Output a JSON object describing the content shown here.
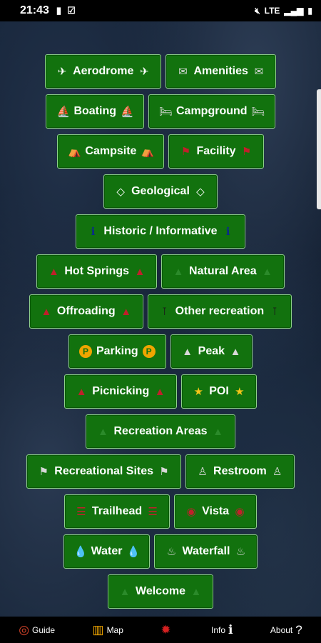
{
  "status": {
    "time": "21:43",
    "left_icons": [
      "bag-icon",
      "check-box-icon"
    ],
    "right_icons": [
      "mute-icon",
      "LTE",
      "signal-icon",
      "battery-icon"
    ],
    "lte": "LTE"
  },
  "buttons": [
    {
      "label": "Aerodrome",
      "icon": "✈",
      "color": "white",
      "name": "aerodrome"
    },
    {
      "label": "Amenities",
      "icon": "✉",
      "color": "grey",
      "name": "amenities"
    },
    {
      "label": "Boating",
      "icon": "⛵",
      "color": "navy",
      "name": "boating"
    },
    {
      "label": "Campground",
      "icon": "🛏",
      "color": "grey",
      "name": "campground"
    },
    {
      "label": "Campsite",
      "icon": "⛺",
      "color": "olive",
      "name": "campsite"
    },
    {
      "label": "Facility",
      "icon": "⚑",
      "color": "red",
      "name": "facility"
    },
    {
      "label": "Geological",
      "icon": "◇",
      "color": "white",
      "name": "geological"
    },
    {
      "label": "Historic / Informative",
      "icon": "ℹ",
      "color": "navy",
      "name": "historic-informative"
    },
    {
      "label": "Hot Springs",
      "icon": "▲",
      "color": "red",
      "name": "hot-springs"
    },
    {
      "label": "Natural Area",
      "icon": "▲",
      "color": "green",
      "name": "natural-area"
    },
    {
      "label": "Offroading",
      "icon": "▲",
      "color": "red",
      "name": "offroading"
    },
    {
      "label": "Other recreation",
      "icon": "⊺",
      "color": "dark",
      "name": "other-recreation"
    },
    {
      "label": "Parking",
      "icon": "P",
      "color": "gold",
      "name": "parking"
    },
    {
      "label": "Peak",
      "icon": "▲",
      "color": "grey",
      "name": "peak"
    },
    {
      "label": "Picnicking",
      "icon": "▲",
      "color": "red",
      "name": "picnicking"
    },
    {
      "label": "POI",
      "icon": "★",
      "color": "gold",
      "name": "poi"
    },
    {
      "label": "Recreation Areas",
      "icon": "▲",
      "color": "green",
      "name": "recreation-areas"
    },
    {
      "label": "Recreational Sites",
      "icon": "⚑",
      "color": "grey",
      "name": "recreational-sites"
    },
    {
      "label": "Restroom",
      "icon": "♙",
      "color": "grey",
      "name": "restroom"
    },
    {
      "label": "Trailhead",
      "icon": "☰",
      "color": "red",
      "name": "trailhead"
    },
    {
      "label": "Vista",
      "icon": "◉",
      "color": "red",
      "name": "vista"
    },
    {
      "label": "Water",
      "icon": "💧",
      "color": "blue",
      "name": "water"
    },
    {
      "label": "Waterfall",
      "icon": "♨",
      "color": "grey",
      "name": "waterfall"
    },
    {
      "label": "Welcome",
      "icon": "▲",
      "color": "green",
      "name": "welcome"
    }
  ],
  "tabs": [
    {
      "label": "Guide",
      "icon": "compass-icon",
      "glyph": "◎",
      "color": "#d9442a"
    },
    {
      "label": "Map",
      "icon": "map-icon",
      "glyph": "▥",
      "color": "#f0a500"
    },
    {
      "label": "",
      "icon": "gear-icon",
      "glyph": "✹",
      "color": "#d62020"
    },
    {
      "label": "Info",
      "icon": "info-icon",
      "glyph": "ℹ",
      "color": "#ffffff"
    },
    {
      "label": "About",
      "icon": "question-icon",
      "glyph": "?",
      "color": "#ffffff"
    }
  ]
}
